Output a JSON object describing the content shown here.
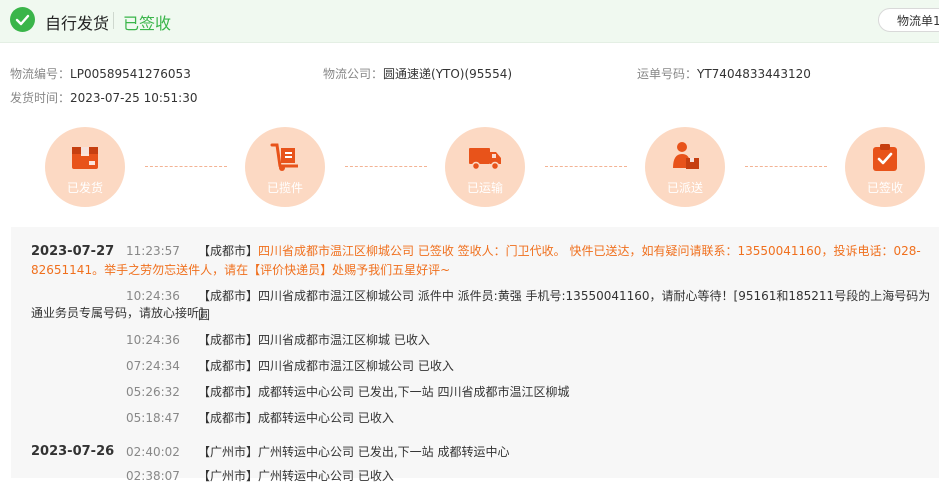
{
  "header": {
    "title": "自行发货",
    "status": "已签收",
    "button_label": "物流单1"
  },
  "info": {
    "tracking_no_label": "物流编号：",
    "tracking_no": "LP00589541276053",
    "company_label": "物流公司：",
    "company": "圆通速递(YTO)(95554)",
    "waybill_label": "运单号码：",
    "waybill": "YT7404833443120",
    "ship_time_label": "发货时间：",
    "ship_time": "2023-07-25 10:51:30"
  },
  "steps": [
    {
      "label": "已发货",
      "icon": "box-icon"
    },
    {
      "label": "已揽件",
      "icon": "handtruck-icon"
    },
    {
      "label": "已运输",
      "icon": "truck-icon"
    },
    {
      "label": "已派送",
      "icon": "courier-icon"
    },
    {
      "label": "已签收",
      "icon": "signed-icon"
    }
  ],
  "colors": {
    "accent": "#3ab54a",
    "step_bg": "#fcd9c3",
    "highlight": "#f0701e"
  },
  "timeline": [
    {
      "date": "2023-07-27",
      "events": [
        {
          "time": "11:23:57",
          "city": "【成都市】",
          "line1": "四川省成都市温江区柳城公司 已签收 签收人：门卫代收。 快件已送达，如有疑问请联系：13550041160，投诉电话：028-",
          "line2": "82651141。举手之劳勿忘送件人，请在【评价快递员】处赐予我们五星好评~"
        },
        {
          "time": "10:24:36",
          "city": "【成都市】",
          "line1": "四川省成都市温江区柳城公司 派件中 派件员:黄强 手机号:13550041160，请耐心等待！[95161和185211号段的上海号码为圆",
          "line2": "通业务员专属号码，请放心接听]"
        },
        {
          "time": "10:24:36",
          "city": "【成都市】",
          "line1": "四川省成都市温江区柳城 已收入"
        },
        {
          "time": "07:24:34",
          "city": "【成都市】",
          "line1": "四川省成都市温江区柳城公司 已收入"
        },
        {
          "time": "05:26:32",
          "city": "【成都市】",
          "line1": "成都转运中心公司 已发出,下一站 四川省成都市温江区柳城"
        },
        {
          "time": "05:18:47",
          "city": "【成都市】",
          "line1": "成都转运中心公司 已收入"
        }
      ]
    },
    {
      "date": "2023-07-26",
      "events": [
        {
          "time": "02:40:02",
          "city": "【广州市】",
          "line1": "广州转运中心公司 已发出,下一站 成都转运中心"
        },
        {
          "time": "02:38:07",
          "city": "【广州市】",
          "line1": "广州转运中心公司 已收入"
        }
      ]
    }
  ]
}
